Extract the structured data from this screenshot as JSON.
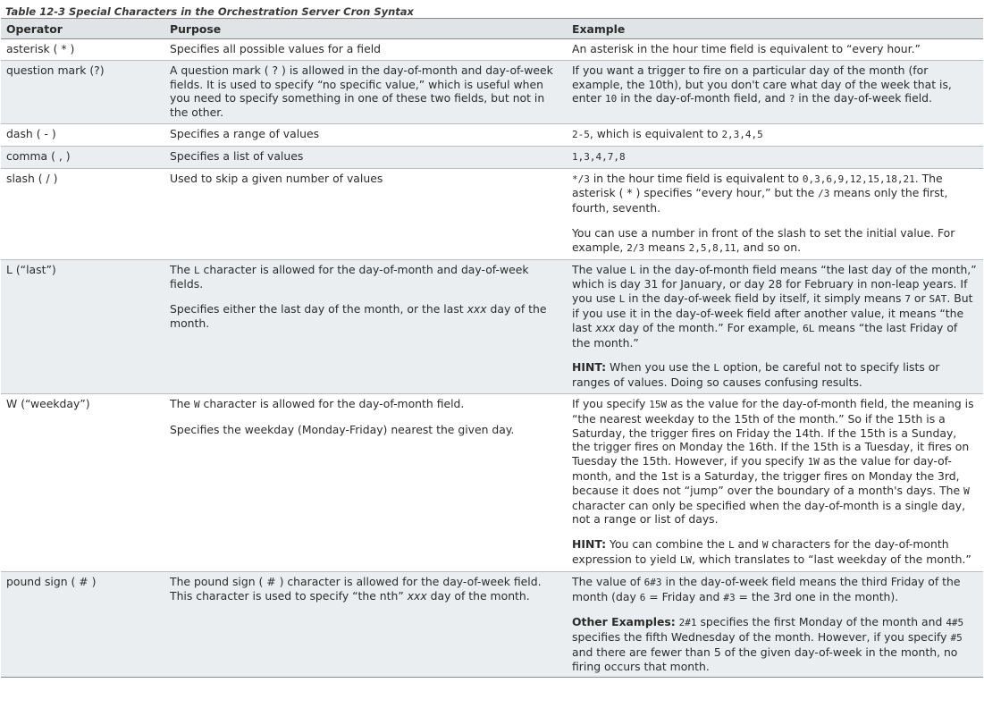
{
  "caption": "Table 12-3 Special Characters in the Orchestration Server Cron Syntax",
  "headers": {
    "operator": "Operator",
    "purpose": "Purpose",
    "example": "Example"
  },
  "rows": [
    {
      "operator": "asterisk ( * )",
      "purpose": [
        [
          {
            "t": "Specifies all possible values for a field"
          }
        ]
      ],
      "example": [
        [
          {
            "t": "An asterisk in the hour time field is equivalent to “every hour.”"
          }
        ]
      ]
    },
    {
      "operator": "question mark (?)",
      "purpose": [
        [
          {
            "t": "A question mark ( ? ) is allowed in the day-of-month and day-of-week fields. It is used to specify “no specific value,” which is useful when you need to specify something in one of these two fields, but not in the other."
          }
        ]
      ],
      "example": [
        [
          {
            "t": "If you want a trigger to fire on a particular day of the month (for example, the 10th), but you don't care what day of the week that is, enter "
          },
          {
            "t": "10",
            "s": "mono"
          },
          {
            "t": " in the day-of-month field, and "
          },
          {
            "t": "?",
            "s": "mono"
          },
          {
            "t": " in the day-of-week field."
          }
        ]
      ]
    },
    {
      "operator": "dash ( - )",
      "purpose": [
        [
          {
            "t": "Specifies a range of values"
          }
        ]
      ],
      "example": [
        [
          {
            "t": "2-5",
            "s": "mono"
          },
          {
            "t": ", which is equivalent to "
          },
          {
            "t": "2,3,4,5",
            "s": "mono"
          }
        ]
      ]
    },
    {
      "operator": "comma ( , )",
      "purpose": [
        [
          {
            "t": "Specifies a list of values"
          }
        ]
      ],
      "example": [
        [
          {
            "t": "1,3,4,7,8",
            "s": "mono"
          }
        ]
      ]
    },
    {
      "operator": "slash ( / )",
      "purpose": [
        [
          {
            "t": "Used to skip a given number of values"
          }
        ]
      ],
      "example": [
        [
          {
            "t": "*/3",
            "s": "mono"
          },
          {
            "t": " in the hour time field is equivalent to "
          },
          {
            "t": "0,3,6,9,12,15,18,21",
            "s": "mono"
          },
          {
            "t": ". The asterisk ( * ) specifies “every hour,” but the "
          },
          {
            "t": "/3",
            "s": "mono"
          },
          {
            "t": " means only the first, fourth, seventh."
          }
        ],
        [
          {
            "t": "You can use a number in front of the slash to set the initial value. For example, "
          },
          {
            "t": "2/3",
            "s": "mono"
          },
          {
            "t": " means "
          },
          {
            "t": "2,5,8,11",
            "s": "mono"
          },
          {
            "t": ", and so on."
          }
        ]
      ]
    },
    {
      "operator": "L (“last”)",
      "purpose": [
        [
          {
            "t": "The "
          },
          {
            "t": "L",
            "s": "mono"
          },
          {
            "t": " character is allowed for the day-of-month and day-of-week fields."
          }
        ],
        [
          {
            "t": "Specifies either the last day of the month, or the last "
          },
          {
            "t": "xxx",
            "s": "em"
          },
          {
            "t": " day of the month."
          }
        ]
      ],
      "example": [
        [
          {
            "t": "The value "
          },
          {
            "t": "L",
            "s": "mono"
          },
          {
            "t": " in the day-of-month field means “the last day of the month,” which is day 31 for January, or day 28 for February in non-leap years. If you use "
          },
          {
            "t": "L",
            "s": "mono"
          },
          {
            "t": " in the day-of-week field by itself, it simply means "
          },
          {
            "t": "7",
            "s": "mono"
          },
          {
            "t": " or "
          },
          {
            "t": "SAT",
            "s": "mono"
          },
          {
            "t": ". But if you use it in the day-of-week field after another value, it means “the last "
          },
          {
            "t": "xxx",
            "s": "em"
          },
          {
            "t": " day of the month.” For example, "
          },
          {
            "t": "6L",
            "s": "mono"
          },
          {
            "t": " means “the last Friday of the month.”"
          }
        ],
        [
          {
            "t": "HINT:",
            "s": "b"
          },
          {
            "t": " When you use the "
          },
          {
            "t": "L",
            "s": "mono"
          },
          {
            "t": " option, be careful not to specify lists or ranges of values. Doing so causes confusing results."
          }
        ]
      ]
    },
    {
      "operator": "W (“weekday”)",
      "purpose": [
        [
          {
            "t": "The "
          },
          {
            "t": "W",
            "s": "mono"
          },
          {
            "t": " character is allowed for the day-of-month field."
          }
        ],
        [
          {
            "t": "Specifies the weekday (Monday-Friday) nearest the given day."
          }
        ]
      ],
      "example": [
        [
          {
            "t": "If you specify "
          },
          {
            "t": "15W",
            "s": "mono"
          },
          {
            "t": " as the value for the day-of-month field, the meaning is “the nearest weekday to the 15th of the month.” So if the 15th is a Saturday, the trigger fires on Friday the 14th. If the 15th is a Sunday, the trigger fires on Monday the 16th. If the 15th is a Tuesday, it fires on Tuesday the 15th. However, if you specify "
          },
          {
            "t": "1W",
            "s": "mono"
          },
          {
            "t": " as the value for day-of-month, and the 1st is a Saturday, the trigger fires on Monday the 3rd, because it does not “jump” over the boundary of a month's days. The "
          },
          {
            "t": "W",
            "s": "mono"
          },
          {
            "t": " character can only be specified when the day-of-month is a single day, not a range or list of days."
          }
        ],
        [
          {
            "t": "HINT:",
            "s": "b"
          },
          {
            "t": " You can combine the "
          },
          {
            "t": "L",
            "s": "mono"
          },
          {
            "t": " and "
          },
          {
            "t": "W",
            "s": "mono"
          },
          {
            "t": " characters for the day-of-month expression to yield "
          },
          {
            "t": "LW",
            "s": "mono"
          },
          {
            "t": ", which translates to “last weekday of the month.”"
          }
        ]
      ]
    },
    {
      "operator": "pound sign ( # )",
      "purpose": [
        [
          {
            "t": "The pound sign ( # ) character is allowed for the day-of-week field. This character is used to specify “the nth” "
          },
          {
            "t": "xxx",
            "s": "em"
          },
          {
            "t": " day of the month."
          }
        ]
      ],
      "example": [
        [
          {
            "t": "The value of "
          },
          {
            "t": "6#3",
            "s": "mono"
          },
          {
            "t": " in the day-of-week field means the third Friday of the month (day "
          },
          {
            "t": "6",
            "s": "mono"
          },
          {
            "t": " = Friday and "
          },
          {
            "t": "#3",
            "s": "mono"
          },
          {
            "t": " = the 3rd one in the month)."
          }
        ],
        [
          {
            "t": "Other Examples:",
            "s": "b"
          },
          {
            "t": " "
          },
          {
            "t": "2#1",
            "s": "mono"
          },
          {
            "t": " specifies the first Monday of the month and "
          },
          {
            "t": "4#5",
            "s": "mono"
          },
          {
            "t": " specifies the fifth Wednesday of the month. However, if you specify "
          },
          {
            "t": "#5",
            "s": "mono"
          },
          {
            "t": " and there are fewer than 5 of the given day-of-week in the month, no firing occurs that month."
          }
        ]
      ]
    }
  ]
}
